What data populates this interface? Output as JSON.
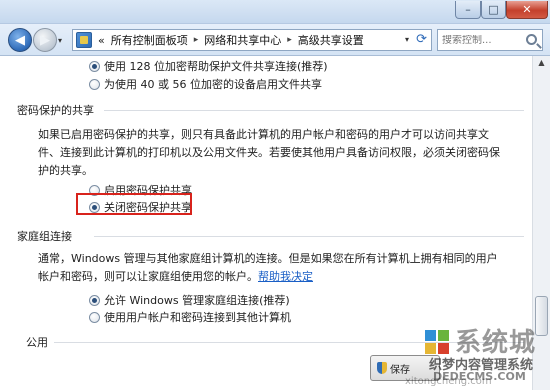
{
  "window": {
    "minimize_glyph": "–",
    "maximize_glyph": "□",
    "close_glyph": "✕"
  },
  "nav": {
    "back_icon": "back-arrow-icon",
    "forward_icon": "forward-arrow-icon",
    "recent_glyph": "▾",
    "address": {
      "prefix": "«",
      "crumbs": [
        "所有控制面板项",
        "网络和共享中心",
        "高级共享设置"
      ],
      "separator": "▸"
    },
    "refresh_glyph": "⟳",
    "search_placeholder": "搜索控制..."
  },
  "options_top": [
    {
      "label": "使用 128 位加密帮助保护文件共享连接(推荐)",
      "checked": true
    },
    {
      "label": "为使用 40 或 56 位加密的设备启用文件共享",
      "checked": false
    }
  ],
  "password_section": {
    "title": "密码保护的共享",
    "description": "如果已启用密码保护的共享，则只有具备此计算机的用户帐户和密码的用户才可以访问共享文件、连接到此计算机的打印机以及公用文件夹。若要使其他用户具备访问权限，必须关闭密码保护的共享。",
    "options": [
      {
        "label": "启用密码保护共享",
        "checked": false
      },
      {
        "label": "关闭密码保护共享",
        "checked": true
      }
    ]
  },
  "homegroup_section": {
    "title": "家庭组连接",
    "description": "通常，Windows 管理与其他家庭组计算机的连接。但是如果您在所有计算机上拥有相同的用户帐户和密码，则可以让家庭组使用您的帐户。",
    "help_link": "帮助我决定",
    "options": [
      {
        "label": "允许 Windows 管理家庭组连接(推荐)",
        "checked": true
      },
      {
        "label": "使用用户帐户和密码连接到其他计算机",
        "checked": false
      }
    ]
  },
  "public_section": {
    "title": "公用"
  },
  "save_button": {
    "label": "保存",
    "icon": "shield-icon"
  },
  "watermark": {
    "logo_text": "系统城",
    "line1": "织梦内容管理系统",
    "line2": "DEDECMS.COM",
    "bottom": "xitongcheng.com"
  },
  "colors": {
    "highlight_border": "#d8231c",
    "link": "#1a5fc6",
    "nav_gradient_top": "#e6effa"
  }
}
